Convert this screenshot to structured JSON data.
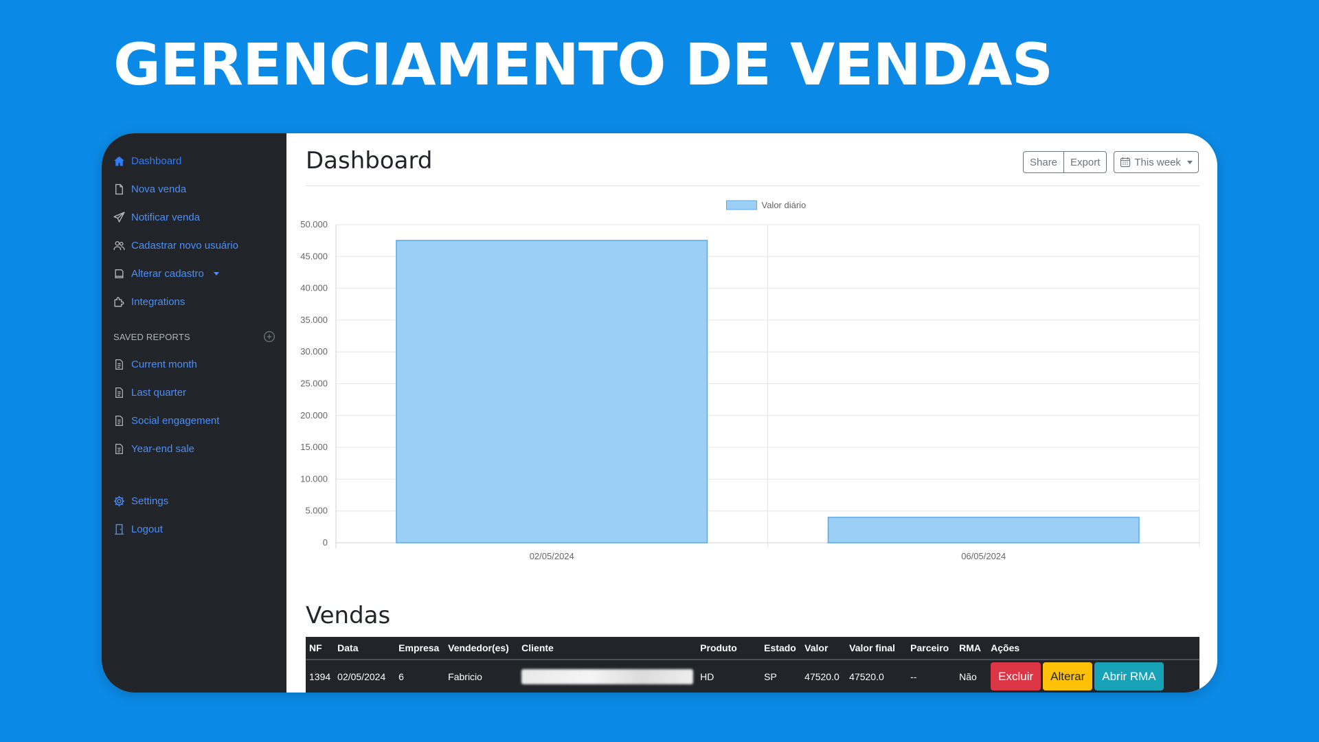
{
  "banner": {
    "title": "GERENCIAMENTO DE VENDAS"
  },
  "sidebar": {
    "items": [
      {
        "label": "Dashboard",
        "icon": "home-icon"
      },
      {
        "label": "Nova venda",
        "icon": "file-icon"
      },
      {
        "label": "Notificar venda",
        "icon": "send-icon"
      },
      {
        "label": "Cadastrar novo usuário",
        "icon": "users-icon"
      },
      {
        "label": "Alterar cadastro",
        "icon": "layers-icon"
      },
      {
        "label": "Integrations",
        "icon": "puzzle-icon"
      }
    ],
    "saved_reports_heading": "SAVED REPORTS",
    "reports": [
      "Current month",
      "Last quarter",
      "Social engagement",
      "Year-end sale"
    ],
    "bottom": [
      {
        "label": "Settings",
        "icon": "gear-icon"
      },
      {
        "label": "Logout",
        "icon": "door-icon"
      }
    ]
  },
  "main": {
    "title": "Dashboard",
    "share_label": "Share",
    "export_label": "Export",
    "period_label": "This week"
  },
  "chart_data": {
    "type": "bar",
    "categories": [
      "02/05/2024",
      "06/05/2024"
    ],
    "series": [
      {
        "name": "Valor diário",
        "values": [
          47520,
          4000
        ]
      }
    ],
    "ylim": [
      0,
      50000
    ],
    "yticks": [
      0,
      5000,
      10000,
      15000,
      20000,
      25000,
      30000,
      35000,
      40000,
      45000,
      50000
    ],
    "ytick_labels": [
      "0",
      "5.000",
      "10.000",
      "15.000",
      "20.000",
      "25.000",
      "30.000",
      "35.000",
      "40.000",
      "45.000",
      "50.000"
    ],
    "legend": "top-center",
    "grid": true,
    "colors": {
      "fill": "#9bcff5",
      "stroke": "#55aaf0"
    }
  },
  "sales": {
    "title": "Vendas",
    "columns": [
      "NF",
      "Data",
      "Empresa",
      "Vendedor(es)",
      "Cliente",
      "Produto",
      "Estado",
      "Valor",
      "Valor final",
      "Parceiro",
      "RMA",
      "Ações"
    ],
    "rows": [
      {
        "nf": "1394",
        "data": "02/05/2024",
        "empresa": "6",
        "vendedor": "Fabricio",
        "produto": "HD",
        "estado": "SP",
        "valor": "47520.0",
        "valor_final": "47520.0",
        "parceiro": "--",
        "rma": "Não"
      }
    ],
    "actions": {
      "delete": "Excluir",
      "edit": "Alterar",
      "rma": "Abrir RMA"
    }
  }
}
